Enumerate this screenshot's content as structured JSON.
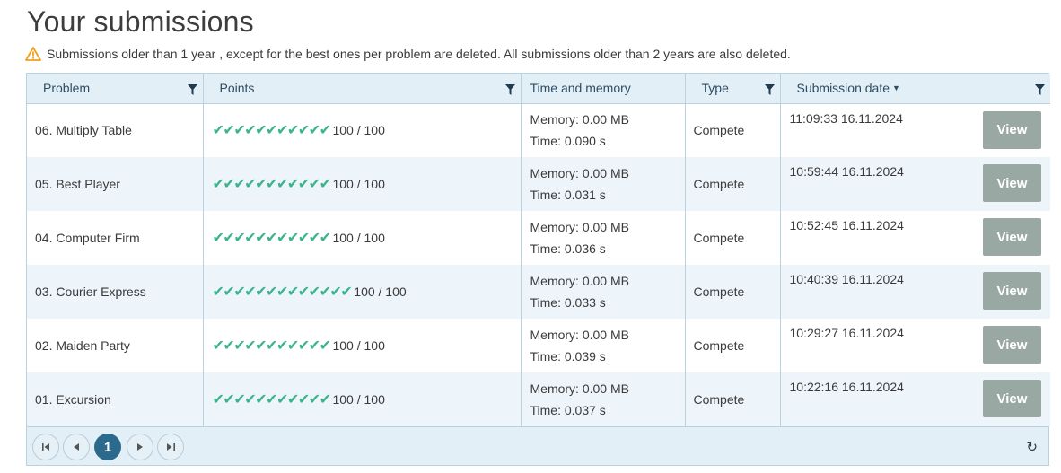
{
  "page": {
    "title": "Your submissions",
    "notice": "Submissions older than 1 year , except for the best ones per problem are deleted. All submissions older than 2 years are also deleted."
  },
  "colors": {
    "header_bg": "#e3eff7",
    "check": "#3bb38c",
    "view_button": "#9aa8a4",
    "current_page": "#2b6a8d",
    "warning": "#f0a020"
  },
  "columns": {
    "problem": "Problem",
    "points": "Points",
    "time_memory": "Time and memory",
    "type": "Type",
    "submission_date": "Submission date",
    "sort_indicator": "▼"
  },
  "rows": [
    {
      "problem": "06. Multiply Table",
      "checks": "✔✔✔✔✔✔✔✔✔✔✔",
      "tests_passed": 11,
      "points": "100 / 100",
      "memory": "Memory: 0.00 MB",
      "time": "Time: 0.090 s",
      "type": "Compete",
      "date": "11:09:33 16.11.2024",
      "action": "View"
    },
    {
      "problem": "05. Best Player",
      "checks": "✔✔✔✔✔✔✔✔✔✔✔",
      "tests_passed": 11,
      "points": "100 / 100",
      "memory": "Memory: 0.00 MB",
      "time": "Time: 0.031 s",
      "type": "Compete",
      "date": "10:59:44 16.11.2024",
      "action": "View"
    },
    {
      "problem": "04. Computer Firm",
      "checks": "✔✔✔✔✔✔✔✔✔✔✔",
      "tests_passed": 11,
      "points": "100 / 100",
      "memory": "Memory: 0.00 MB",
      "time": "Time: 0.036 s",
      "type": "Compete",
      "date": "10:52:45 16.11.2024",
      "action": "View"
    },
    {
      "problem": "03. Courier Express",
      "checks": "✔✔✔✔✔✔✔✔✔✔✔✔✔",
      "tests_passed": 13,
      "points": "100 / 100",
      "memory": "Memory: 0.00 MB",
      "time": "Time: 0.033 s",
      "type": "Compete",
      "date": "10:40:39 16.11.2024",
      "action": "View"
    },
    {
      "problem": "02. Maiden Party",
      "checks": "✔✔✔✔✔✔✔✔✔✔✔",
      "tests_passed": 11,
      "points": "100 / 100",
      "memory": "Memory: 0.00 MB",
      "time": "Time: 0.039 s",
      "type": "Compete",
      "date": "10:29:27 16.11.2024",
      "action": "View"
    },
    {
      "problem": "01. Excursion",
      "checks": "✔✔✔✔✔✔✔✔✔✔✔",
      "tests_passed": 11,
      "points": "100 / 100",
      "memory": "Memory: 0.00 MB",
      "time": "Time: 0.037 s",
      "type": "Compete",
      "date": "10:22:16 16.11.2024",
      "action": "View"
    }
  ],
  "pager": {
    "first": "◀",
    "prev": "◀",
    "current": "1",
    "next": "▶",
    "last": "▶",
    "refresh": "↻"
  },
  "icons": {
    "warning": "warning-triangle-icon",
    "filter": "filter-icon",
    "refresh": "refresh-icon"
  }
}
